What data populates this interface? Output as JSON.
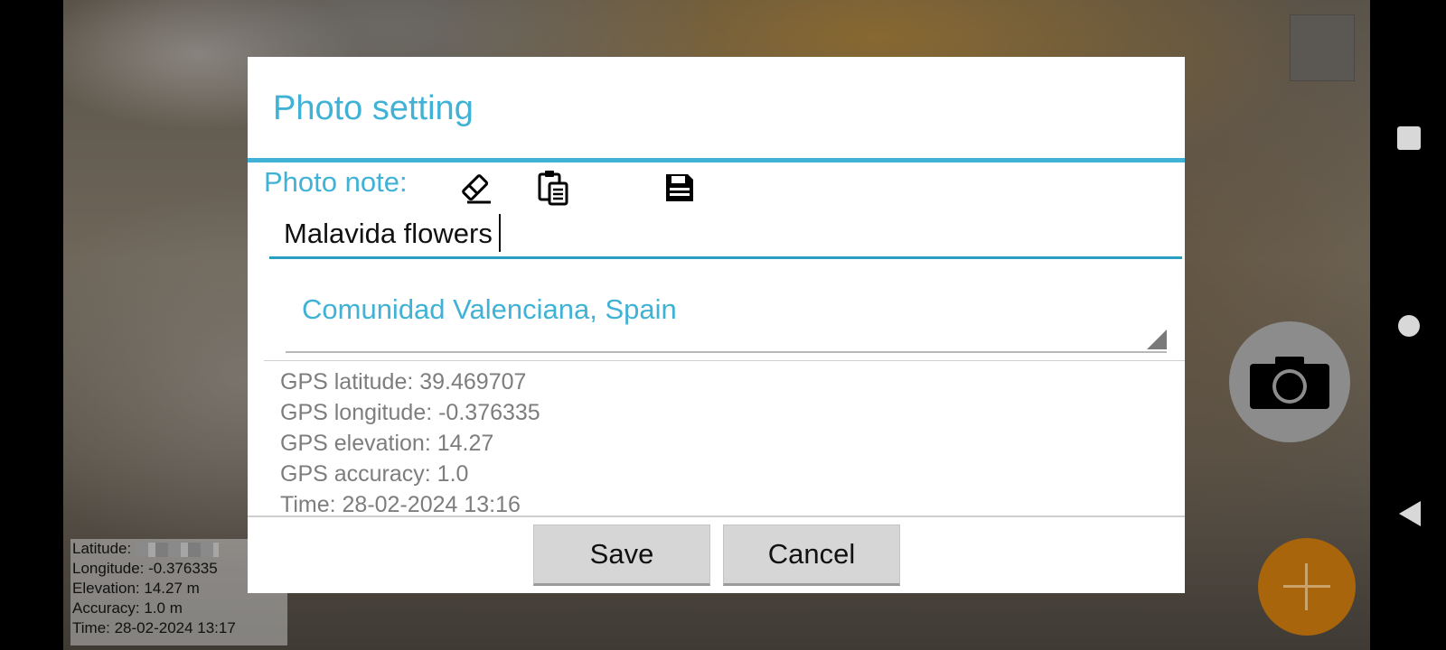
{
  "dialog": {
    "title": "Photo setting",
    "note_label": "Photo note:",
    "note_value": "Malavida flowers",
    "toolbar_icons": [
      "eraser-icon",
      "clipboard-icon",
      "save-disk-icon"
    ],
    "location_selected": "Comunidad Valenciana, Spain",
    "gps": [
      "GPS latitude: 39.469707",
      "GPS longitude: -0.376335",
      "GPS elevation: 14.27",
      "GPS accuracy: 1.0",
      "Time: 28-02-2024 13:16"
    ],
    "save_label": "Save",
    "cancel_label": "Cancel"
  },
  "overlay": {
    "latitude_label": "Latitude:",
    "longitude": "Longitude: -0.376335",
    "elevation": "Elevation: 14.27 m",
    "accuracy": "Accuracy: 1.0 m",
    "time": "Time: 28-02-2024 13:17"
  },
  "colors": {
    "accent": "#40b2d6",
    "fab": "#a8650b",
    "shutter": "#8c8c8c"
  },
  "camera_controls": [
    "camera-icon",
    "plus-icon"
  ],
  "nav_icons": [
    "recents-square-icon",
    "home-circle-icon",
    "back-triangle-icon"
  ]
}
